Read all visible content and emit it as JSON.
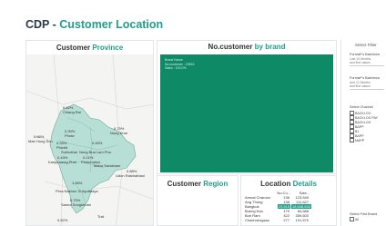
{
  "header": {
    "title_prefix": "CDP - ",
    "title_accent": "Customer Location"
  },
  "province": {
    "title_main": "Customer ",
    "title_accent": "Province",
    "labels": [
      {
        "text": "0.62%",
        "name": "map-label-0"
      },
      {
        "text": "Chiang Rai",
        "name": "map-label-1"
      },
      {
        "text": "0.66%",
        "name": "map-label-2"
      },
      {
        "text": "Mae Hong Son",
        "name": "map-label-3"
      },
      {
        "text": "0.39%",
        "name": "map-label-4"
      },
      {
        "text": "Phrae",
        "name": "map-label-5"
      },
      {
        "text": "0.75%",
        "name": "map-label-6"
      },
      {
        "text": "Nong Khai",
        "name": "map-label-7"
      },
      {
        "text": "0.33%",
        "name": "map-label-8"
      },
      {
        "text": "Phichit",
        "name": "map-label-9"
      },
      {
        "text": "0.45%",
        "name": "map-label-10"
      },
      {
        "text": "Sukhothai",
        "name": "map-label-11"
      },
      {
        "text": "Nong Bua Lam Phu",
        "name": "map-label-12"
      },
      {
        "text": "0.43%",
        "name": "map-label-13"
      },
      {
        "text": "Kamphaeng Phet",
        "name": "map-label-14"
      },
      {
        "text": "0.21%",
        "name": "map-label-15"
      },
      {
        "text": "Phetchabun",
        "name": "map-label-16"
      },
      {
        "text": "Maha Sarakham",
        "name": "map-label-17"
      },
      {
        "text": "0.88%",
        "name": "map-label-18"
      },
      {
        "text": "Udon Ratchathani",
        "name": "map-label-19"
      },
      {
        "text": "1.56%",
        "name": "map-label-20"
      },
      {
        "text": "Phra Nakhon Si Ayutthaya",
        "name": "map-label-21"
      },
      {
        "text": "0.79%",
        "name": "map-label-22"
      },
      {
        "text": "Samut Songkhram",
        "name": "map-label-23"
      },
      {
        "text": "0.52%",
        "name": "map-label-24"
      },
      {
        "text": "Trat",
        "name": "map-label-25"
      }
    ]
  },
  "brand": {
    "title_main": "No.customer ",
    "title_accent": "by brand",
    "treemap": {
      "brand": "Brand Name",
      "count": "No.customer : 23515",
      "share": "Sales : 100.0%"
    }
  },
  "region": {
    "title_main": "Customer ",
    "title_accent": "Region"
  },
  "location": {
    "title_main": "Location ",
    "title_accent": "Details",
    "columns": [
      "",
      "No.Cu...",
      "Sale..."
    ],
    "rows": [
      {
        "name": "Amnat Charoen",
        "count": "136",
        "sales": "123,540"
      },
      {
        "name": "Ang Thong",
        "count": "136",
        "sales": "111,627"
      },
      {
        "name": "Bangkok",
        "count": "23,515",
        "sales": "18,608,843"
      },
      {
        "name": "Bueng Kan",
        "count": "170",
        "sales": "84,588"
      },
      {
        "name": "Buri Ram",
        "count": "422",
        "sales": "359,600"
      },
      {
        "name": "Chachoengsao",
        "count": "277",
        "sales": "191,570"
      }
    ]
  },
  "filters": {
    "title": "Select Filter",
    "f1_label": "Format*'s Batchrow",
    "f1_sub": "Last 10 Months",
    "f1_sub2": "and first values",
    "f2_label": "Format*'s Batchrow",
    "f2_sub": "And 12 Months",
    "f2_sub2": "and first values",
    "f3_label": "Select Channel",
    "channels": [
      "BACKLOG",
      "BACKLOG PAY",
      "BACKLOG",
      "BAPP",
      "B1",
      "BAPP",
      "MAPP"
    ],
    "f4_label": "Select First Brand",
    "f4_opt": "All"
  }
}
